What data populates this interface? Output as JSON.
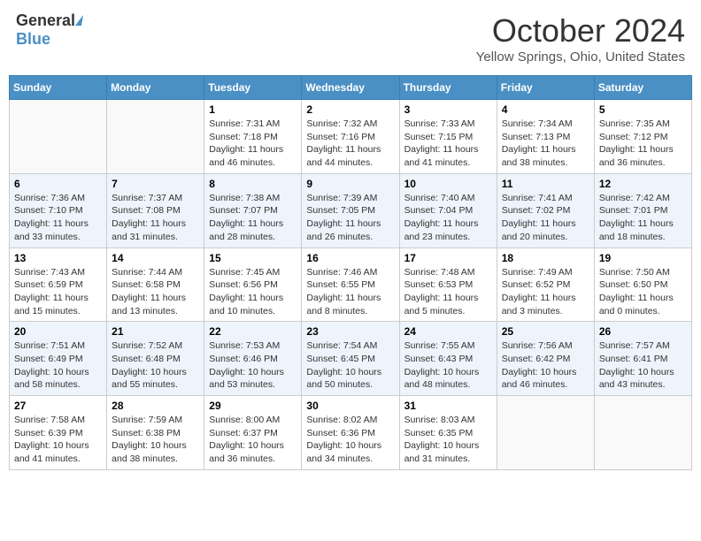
{
  "header": {
    "logo_line1": "General",
    "logo_line2": "Blue",
    "month_title": "October 2024",
    "location": "Yellow Springs, Ohio, United States"
  },
  "days_of_week": [
    "Sunday",
    "Monday",
    "Tuesday",
    "Wednesday",
    "Thursday",
    "Friday",
    "Saturday"
  ],
  "weeks": [
    [
      {
        "day": "",
        "sunrise": "",
        "sunset": "",
        "daylight": ""
      },
      {
        "day": "",
        "sunrise": "",
        "sunset": "",
        "daylight": ""
      },
      {
        "day": "1",
        "sunrise": "Sunrise: 7:31 AM",
        "sunset": "Sunset: 7:18 PM",
        "daylight": "Daylight: 11 hours and 46 minutes."
      },
      {
        "day": "2",
        "sunrise": "Sunrise: 7:32 AM",
        "sunset": "Sunset: 7:16 PM",
        "daylight": "Daylight: 11 hours and 44 minutes."
      },
      {
        "day": "3",
        "sunrise": "Sunrise: 7:33 AM",
        "sunset": "Sunset: 7:15 PM",
        "daylight": "Daylight: 11 hours and 41 minutes."
      },
      {
        "day": "4",
        "sunrise": "Sunrise: 7:34 AM",
        "sunset": "Sunset: 7:13 PM",
        "daylight": "Daylight: 11 hours and 38 minutes."
      },
      {
        "day": "5",
        "sunrise": "Sunrise: 7:35 AM",
        "sunset": "Sunset: 7:12 PM",
        "daylight": "Daylight: 11 hours and 36 minutes."
      }
    ],
    [
      {
        "day": "6",
        "sunrise": "Sunrise: 7:36 AM",
        "sunset": "Sunset: 7:10 PM",
        "daylight": "Daylight: 11 hours and 33 minutes."
      },
      {
        "day": "7",
        "sunrise": "Sunrise: 7:37 AM",
        "sunset": "Sunset: 7:08 PM",
        "daylight": "Daylight: 11 hours and 31 minutes."
      },
      {
        "day": "8",
        "sunrise": "Sunrise: 7:38 AM",
        "sunset": "Sunset: 7:07 PM",
        "daylight": "Daylight: 11 hours and 28 minutes."
      },
      {
        "day": "9",
        "sunrise": "Sunrise: 7:39 AM",
        "sunset": "Sunset: 7:05 PM",
        "daylight": "Daylight: 11 hours and 26 minutes."
      },
      {
        "day": "10",
        "sunrise": "Sunrise: 7:40 AM",
        "sunset": "Sunset: 7:04 PM",
        "daylight": "Daylight: 11 hours and 23 minutes."
      },
      {
        "day": "11",
        "sunrise": "Sunrise: 7:41 AM",
        "sunset": "Sunset: 7:02 PM",
        "daylight": "Daylight: 11 hours and 20 minutes."
      },
      {
        "day": "12",
        "sunrise": "Sunrise: 7:42 AM",
        "sunset": "Sunset: 7:01 PM",
        "daylight": "Daylight: 11 hours and 18 minutes."
      }
    ],
    [
      {
        "day": "13",
        "sunrise": "Sunrise: 7:43 AM",
        "sunset": "Sunset: 6:59 PM",
        "daylight": "Daylight: 11 hours and 15 minutes."
      },
      {
        "day": "14",
        "sunrise": "Sunrise: 7:44 AM",
        "sunset": "Sunset: 6:58 PM",
        "daylight": "Daylight: 11 hours and 13 minutes."
      },
      {
        "day": "15",
        "sunrise": "Sunrise: 7:45 AM",
        "sunset": "Sunset: 6:56 PM",
        "daylight": "Daylight: 11 hours and 10 minutes."
      },
      {
        "day": "16",
        "sunrise": "Sunrise: 7:46 AM",
        "sunset": "Sunset: 6:55 PM",
        "daylight": "Daylight: 11 hours and 8 minutes."
      },
      {
        "day": "17",
        "sunrise": "Sunrise: 7:48 AM",
        "sunset": "Sunset: 6:53 PM",
        "daylight": "Daylight: 11 hours and 5 minutes."
      },
      {
        "day": "18",
        "sunrise": "Sunrise: 7:49 AM",
        "sunset": "Sunset: 6:52 PM",
        "daylight": "Daylight: 11 hours and 3 minutes."
      },
      {
        "day": "19",
        "sunrise": "Sunrise: 7:50 AM",
        "sunset": "Sunset: 6:50 PM",
        "daylight": "Daylight: 11 hours and 0 minutes."
      }
    ],
    [
      {
        "day": "20",
        "sunrise": "Sunrise: 7:51 AM",
        "sunset": "Sunset: 6:49 PM",
        "daylight": "Daylight: 10 hours and 58 minutes."
      },
      {
        "day": "21",
        "sunrise": "Sunrise: 7:52 AM",
        "sunset": "Sunset: 6:48 PM",
        "daylight": "Daylight: 10 hours and 55 minutes."
      },
      {
        "day": "22",
        "sunrise": "Sunrise: 7:53 AM",
        "sunset": "Sunset: 6:46 PM",
        "daylight": "Daylight: 10 hours and 53 minutes."
      },
      {
        "day": "23",
        "sunrise": "Sunrise: 7:54 AM",
        "sunset": "Sunset: 6:45 PM",
        "daylight": "Daylight: 10 hours and 50 minutes."
      },
      {
        "day": "24",
        "sunrise": "Sunrise: 7:55 AM",
        "sunset": "Sunset: 6:43 PM",
        "daylight": "Daylight: 10 hours and 48 minutes."
      },
      {
        "day": "25",
        "sunrise": "Sunrise: 7:56 AM",
        "sunset": "Sunset: 6:42 PM",
        "daylight": "Daylight: 10 hours and 46 minutes."
      },
      {
        "day": "26",
        "sunrise": "Sunrise: 7:57 AM",
        "sunset": "Sunset: 6:41 PM",
        "daylight": "Daylight: 10 hours and 43 minutes."
      }
    ],
    [
      {
        "day": "27",
        "sunrise": "Sunrise: 7:58 AM",
        "sunset": "Sunset: 6:39 PM",
        "daylight": "Daylight: 10 hours and 41 minutes."
      },
      {
        "day": "28",
        "sunrise": "Sunrise: 7:59 AM",
        "sunset": "Sunset: 6:38 PM",
        "daylight": "Daylight: 10 hours and 38 minutes."
      },
      {
        "day": "29",
        "sunrise": "Sunrise: 8:00 AM",
        "sunset": "Sunset: 6:37 PM",
        "daylight": "Daylight: 10 hours and 36 minutes."
      },
      {
        "day": "30",
        "sunrise": "Sunrise: 8:02 AM",
        "sunset": "Sunset: 6:36 PM",
        "daylight": "Daylight: 10 hours and 34 minutes."
      },
      {
        "day": "31",
        "sunrise": "Sunrise: 8:03 AM",
        "sunset": "Sunset: 6:35 PM",
        "daylight": "Daylight: 10 hours and 31 minutes."
      },
      {
        "day": "",
        "sunrise": "",
        "sunset": "",
        "daylight": ""
      },
      {
        "day": "",
        "sunrise": "",
        "sunset": "",
        "daylight": ""
      }
    ]
  ]
}
